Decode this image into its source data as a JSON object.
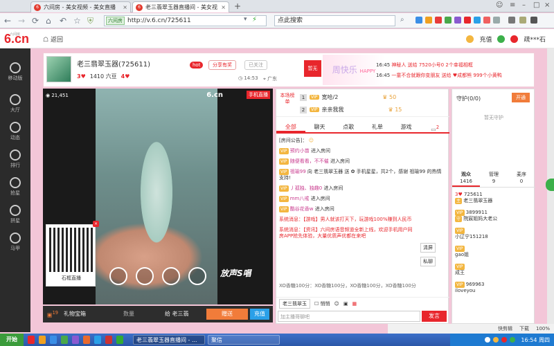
{
  "browser": {
    "tabs": [
      {
        "title": "六间房 - 美女视频 - 美女直播",
        "active": false
      },
      {
        "title": "老三翡翠玉器直播间 - 美女视",
        "active": true
      }
    ],
    "url": "http://v.6.cn/725611",
    "url_chip": "六间房",
    "search_placeholder": "点此搜索",
    "new_tab": "+"
  },
  "site": {
    "logo": "6.cn",
    "logo_small": "六间房",
    "back_label": "返回",
    "user_actions": [
      "充值",
      "疏***石"
    ]
  },
  "left_nav": [
    "移动版",
    "大厅",
    "动态",
    "排行",
    "抢星",
    "拼星",
    "马甲"
  ],
  "room": {
    "title": "老三翡翠玉器(725611)",
    "heart_level": "3",
    "fans": "1410 六豆",
    "level": "4",
    "hot_badge": "hot",
    "share_button": "分享有奖",
    "follow_button": "已关注",
    "time": "14:53",
    "location": "广东",
    "prize": "暂无",
    "banner": "周快乐",
    "banner_tag": "HAPPY",
    "notices": [
      {
        "time": "16:45",
        "text": "神秘人 送给 7520小号0 2个幸福相框"
      },
      {
        "time": "16:45",
        "text": "一童不合就跟你变朋友 送给 ♥成都熊 999个小黄鸭"
      }
    ]
  },
  "video": {
    "viewers": "21,451",
    "brand": "6.cn",
    "phone_live": "手机直播",
    "qr_label": "石框直播",
    "qr_close": "×",
    "overlay_logo": "放声S唱"
  },
  "bottom_bar": {
    "gift_count": "19",
    "gift_label": "礼物宝箱",
    "quantity_label": "数量",
    "recipient": "给 老三翡",
    "send_label": "赠送",
    "recharge_label": "充值"
  },
  "chat": {
    "rank_tag": "本场榜单",
    "rank": [
      {
        "num": "1",
        "name": "宽哈/2",
        "gold": "50"
      },
      {
        "num": "2",
        "name": "亲亲我我",
        "gold": "15"
      }
    ],
    "tabs": [
      "全部",
      "聊天",
      "点歌",
      "礼单",
      "游戏"
    ],
    "tab_badge": "2",
    "messages": [
      {
        "name": "[房间公告]：",
        "text": ""
      },
      {
        "name": "预约小苗",
        "text": "进入房间"
      },
      {
        "name": "随便看看，不不催",
        "text": "进入房间"
      },
      {
        "name": "祖瑜99",
        "text": "向 老三翡翠玉器 送 ✿ 手机星星，共2个，感谢 祖瑜99 的热情支持!"
      },
      {
        "name": "丿孤独、独趣0",
        "text": "进入房间"
      },
      {
        "name": "mm八戒",
        "text": "进入房间"
      },
      {
        "name": "酷谷花香w",
        "text": "进入房间"
      }
    ],
    "system_messages": [
      "系统消息：【游戏】男人就该打天下，玩游戏100%赚到人民币",
      "系统消息：【资讯】六间房语音频道全新上线，欢迎手机用户同房APP抢先体验，大量优质声优都在来吧"
    ],
    "sys_actions": [
      "清屏",
      "私聊"
    ],
    "ticker": "XO香糖100分：XO香糖100分，XO香糖100分，XO香糖100分",
    "to_user": "老三翡翠玉",
    "whisper": "悄悄",
    "input_placeholder": "加主播哥聊吧",
    "send": "发言"
  },
  "right_panel": {
    "guard_title": "守护(0/0)",
    "open_guard": "开通",
    "no_guard": "暂无守护",
    "tabs": [
      {
        "label": "观众",
        "count": "1416"
      },
      {
        "label": "管理",
        "count": "9"
      },
      {
        "label": "麦序",
        "count": "0"
      }
    ],
    "viewers": [
      {
        "id": "725611",
        "name": "老三翡翠玉器"
      },
      {
        "id": "3899911",
        "name": "院宸姐妈大老公"
      },
      {
        "id": "",
        "name": "小辽宁151218"
      },
      {
        "id": "",
        "name": "gao姐"
      },
      {
        "id": "",
        "name": "成王"
      },
      {
        "id": "969963",
        "name": "iloveyou"
      }
    ]
  },
  "status_strip": [
    "快剪辑",
    "下载",
    "100%"
  ],
  "taskbar": {
    "start": "开始",
    "items": [
      "老三翡翠玉器直播间 - ...",
      "聚信"
    ],
    "time": "16:54 周四"
  }
}
